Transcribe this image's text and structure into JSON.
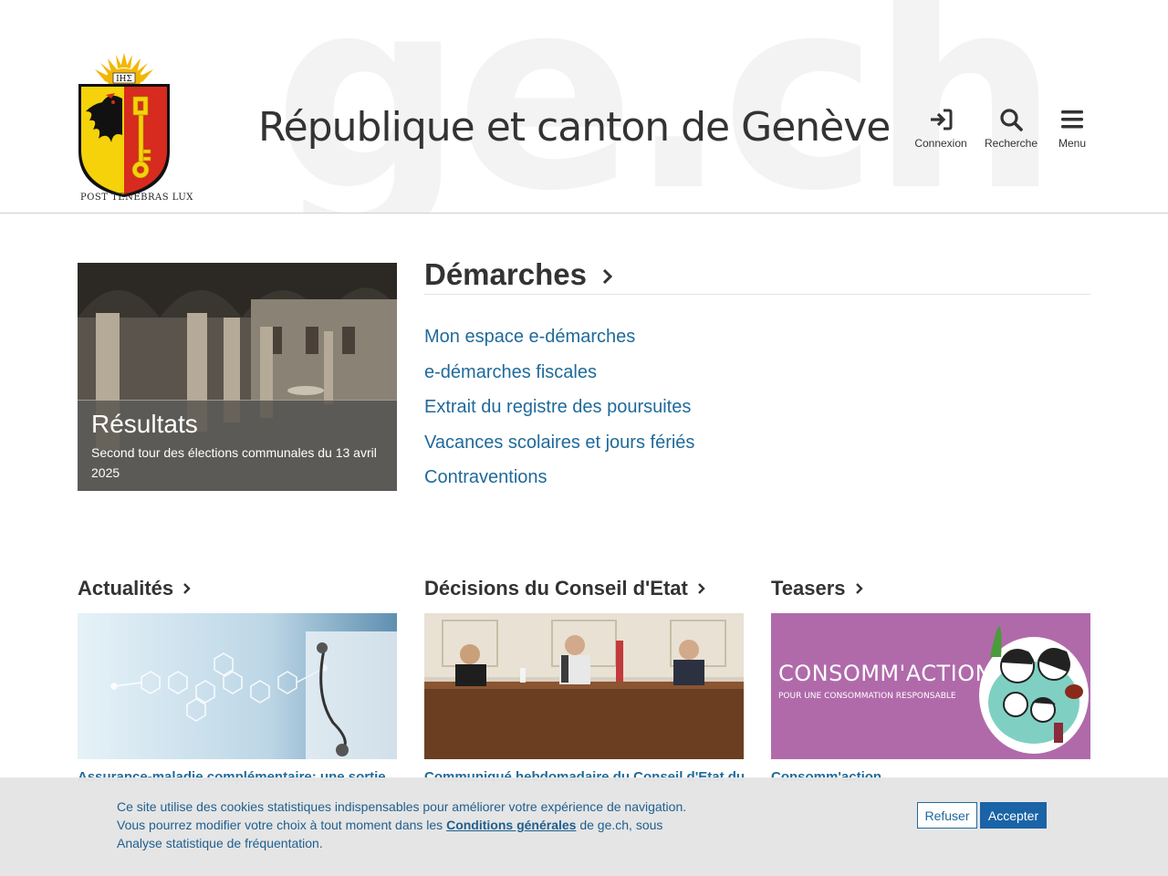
{
  "header": {
    "watermark": "ge.ch",
    "motto": "POST TENEBRAS LUX",
    "title": "République et canton de Genève",
    "actions": {
      "login": "Connexion",
      "search": "Recherche",
      "menu": "Menu"
    }
  },
  "hero": {
    "title": "Résultats",
    "subtitle": "Second tour des élections communales du 13 avril 2025"
  },
  "demarches": {
    "title": "Démarches",
    "links": [
      "Mon espace e-démarches",
      "e-démarches fiscales",
      "Extrait du registre des poursuites",
      "Vacances scolaires et jours fériés",
      "Contraventions"
    ]
  },
  "columns": [
    {
      "title": "Actualités",
      "link": "Assurance-maladie complémentaire: une sortie"
    },
    {
      "title": "Décisions du Conseil d'Etat",
      "link": "Communiqué hebdomadaire du Conseil d'Etat du"
    },
    {
      "title": "Teasers",
      "link": "Consomm'action"
    }
  ],
  "teaser_image": {
    "headline": "CONSOMM'ACTION",
    "tagline": "POUR UNE CONSOMMATION RESPONSABLE",
    "background": "#b06aaa"
  },
  "cookie": {
    "text_before": "Ce site utilise des cookies statistiques indispensables pour améliorer votre expérience de navigation. Vous pourrez modifier votre choix à tout moment dans les ",
    "link": "Conditions générales",
    "text_after": " de ge.ch, sous Analyse statistique de fréquentation.",
    "refuse": "Refuser",
    "accept": "Accepter"
  },
  "colors": {
    "link": "#1f6a9a",
    "accept_button": "#1a63a6"
  }
}
